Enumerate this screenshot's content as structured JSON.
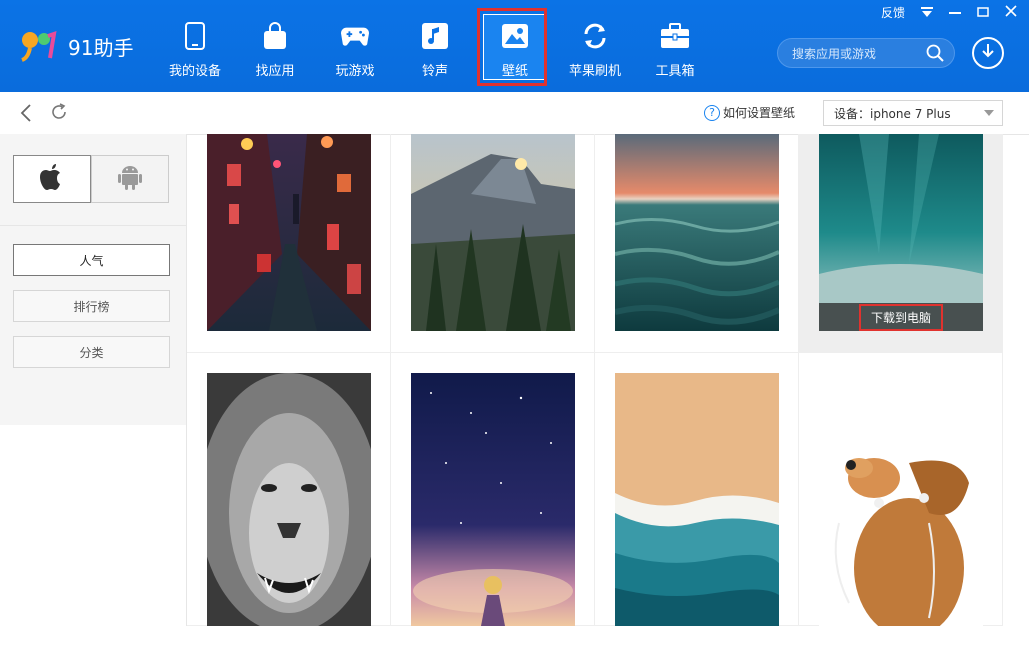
{
  "app": {
    "name": "91助手"
  },
  "window_controls": {
    "feedback": "反馈"
  },
  "nav": [
    {
      "label": "我的设备",
      "icon": "phone-icon"
    },
    {
      "label": "找应用",
      "icon": "bag-icon"
    },
    {
      "label": "玩游戏",
      "icon": "gamepad-icon"
    },
    {
      "label": "铃声",
      "icon": "music-icon"
    },
    {
      "label": "壁纸",
      "icon": "image-icon",
      "active": true
    },
    {
      "label": "苹果刷机",
      "icon": "refresh-icon"
    },
    {
      "label": "工具箱",
      "icon": "toolbox-icon"
    }
  ],
  "search": {
    "placeholder": "搜索应用或游戏"
  },
  "subbar": {
    "help_label": "如何设置壁纸",
    "help_icon": "?",
    "device_label": "设备：iphone 7 Plus"
  },
  "sidebar": {
    "items": [
      "人气",
      "排行榜",
      "分类"
    ]
  },
  "grid": {
    "download_label": "下载到电脑"
  },
  "colors": {
    "brand_blue": "#0b73e6",
    "highlight_red": "#e0322e"
  }
}
